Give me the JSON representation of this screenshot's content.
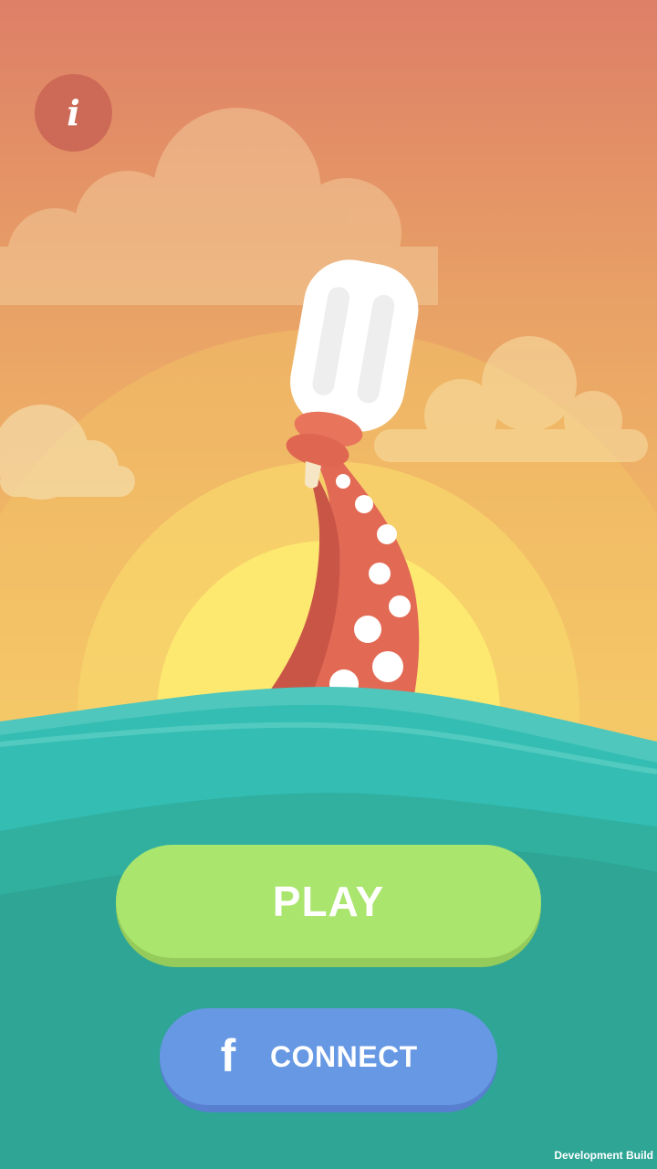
{
  "menu": {
    "info_label": "i",
    "play_label": "PLAY",
    "connect_label": "CONNECT",
    "connect_icon": "facebook-f-icon",
    "connect_icon_glyph": "f"
  },
  "footer": {
    "build_label": "Development Build"
  },
  "colors": {
    "sky_top": "#df8067",
    "sky_bottom": "#f6ce6a",
    "sun": "#fde870",
    "sea": "#31a493",
    "wave_highlight": "#33bdb3",
    "play_button": "#aae56e",
    "connect_button": "#6698e3",
    "tentacle": "#e26a55",
    "popsicle": "#ffffff"
  }
}
